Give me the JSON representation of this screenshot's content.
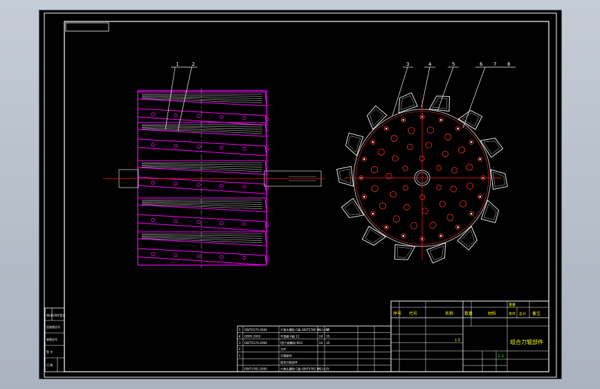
{
  "title_block": {
    "part_title": "组合刀辊部件",
    "scale_value": "1:1",
    "ratio": "1:5",
    "header_labels": [
      "序号",
      "代号",
      "名称",
      "数量",
      "材料",
      "单件",
      "总计",
      "备注"
    ],
    "weight_label": "重量"
  },
  "balloons": [
    "1",
    "2",
    "3",
    "4",
    "5",
    "6",
    "7",
    "8"
  ],
  "parts_list": [
    {
      "no": "5",
      "code": "GB/T6170-2000",
      "name": "六角头螺栓 C级 GB/T5780 M12×60",
      "qty": "4",
      "mat": "35"
    },
    {
      "no": "4",
      "code": "GB95-2002",
      "name": "平垫圈 A级 12",
      "qty": "24",
      "mat": "35"
    },
    {
      "no": "3",
      "code": "GB/T6170-2000",
      "name": "I型六角螺母 M12",
      "qty": "24",
      "mat": "35"
    },
    {
      "no": "2",
      "code": "",
      "name": "刀片",
      "qty": "",
      "mat": ""
    },
    {
      "no": "1",
      "code": "",
      "name": "刀辊组件",
      "qty": "",
      "mat": ""
    },
    {
      "no": "",
      "code": "",
      "name": "组合刀辊部件",
      "qty": "",
      "mat": ""
    },
    {
      "no": "",
      "code": "GB/T5781-2000",
      "name": "六角头螺栓 C级 GB/T5781 M12×25",
      "qty": "4",
      "mat": ""
    }
  ],
  "side_table_labels": [
    "借(通)用件登记",
    "旧底图总号",
    "底图总号",
    "签 字",
    "日 期"
  ],
  "colors": {
    "background": "#000000",
    "border": "#ffffff",
    "part_outline": "#ff00ff",
    "centerline": "#ff2020",
    "hole": "#ff3030",
    "gray_geometry": "#c8c8c8",
    "table_text": "#ffff00",
    "table_green": "#00ff00"
  }
}
